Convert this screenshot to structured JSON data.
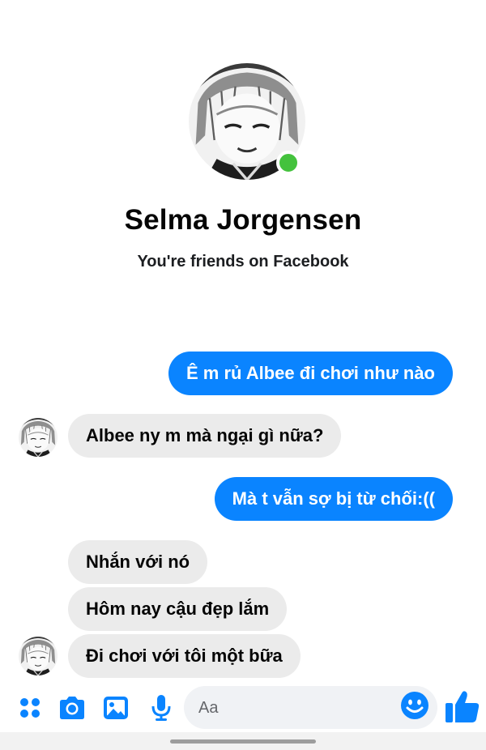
{
  "contact": {
    "name": "Selma Jorgensen",
    "subtitle": "You're friends on Facebook",
    "online": true
  },
  "messages": [
    {
      "direction": "outgoing",
      "text": "Ê m rủ Albee đi chơi như nào"
    },
    {
      "direction": "incoming",
      "text": "Albee ny m mà ngại gì nữa?"
    },
    {
      "direction": "outgoing",
      "text": "Mà t vẫn sợ bị từ chối:(("
    },
    {
      "direction": "incoming",
      "text": "Nhắn với nó"
    },
    {
      "direction": "incoming",
      "text": "Hôm nay cậu đẹp lắm"
    },
    {
      "direction": "incoming",
      "text": "Đi chơi với tôi một bữa"
    }
  ],
  "composer": {
    "placeholder": "Aa",
    "icons": [
      "apps-icon",
      "camera-icon",
      "gallery-icon",
      "microphone-icon",
      "emoji-icon",
      "thumbs-up-icon"
    ]
  },
  "colors": {
    "accent": "#0a84ff",
    "incoming_bubble": "#ebebeb",
    "online": "#44c23d"
  }
}
